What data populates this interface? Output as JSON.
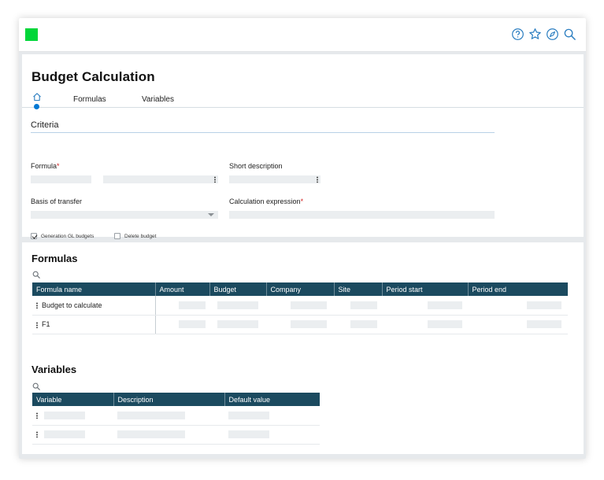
{
  "header": {
    "icons": [
      "help-icon",
      "star-icon",
      "compass-icon",
      "search-icon"
    ],
    "brand_color": "#00d639"
  },
  "page": {
    "title": "Budget Calculation"
  },
  "tabs": [
    {
      "label": "Formulas"
    },
    {
      "label": "Variables"
    }
  ],
  "criteria": {
    "section_title": "Criteria",
    "formula_label": "Formula",
    "short_description_label": "Short description",
    "basis_label": "Basis of transfer",
    "calc_expression_label": "Calculation expression",
    "required_mark": "*",
    "checkbox_generation_label": "Generation GL budgets",
    "checkbox_generation_checked": true,
    "checkbox_delete_label": "Delete budget",
    "checkbox_delete_checked": false
  },
  "formulas": {
    "title": "Formulas",
    "columns": [
      "Formula name",
      "Amount",
      "Budget",
      "Company",
      "Site",
      "Period  start",
      "Period end"
    ],
    "rows": [
      {
        "name": "Budget to calculate"
      },
      {
        "name": "F1"
      }
    ]
  },
  "variables": {
    "title": "Variables",
    "columns": [
      "Variable",
      "Description",
      "Default value"
    ],
    "row_count": 2
  },
  "colors": {
    "table_header": "#1b4a5f",
    "accent": "#0078d4",
    "required": "#d22020"
  }
}
